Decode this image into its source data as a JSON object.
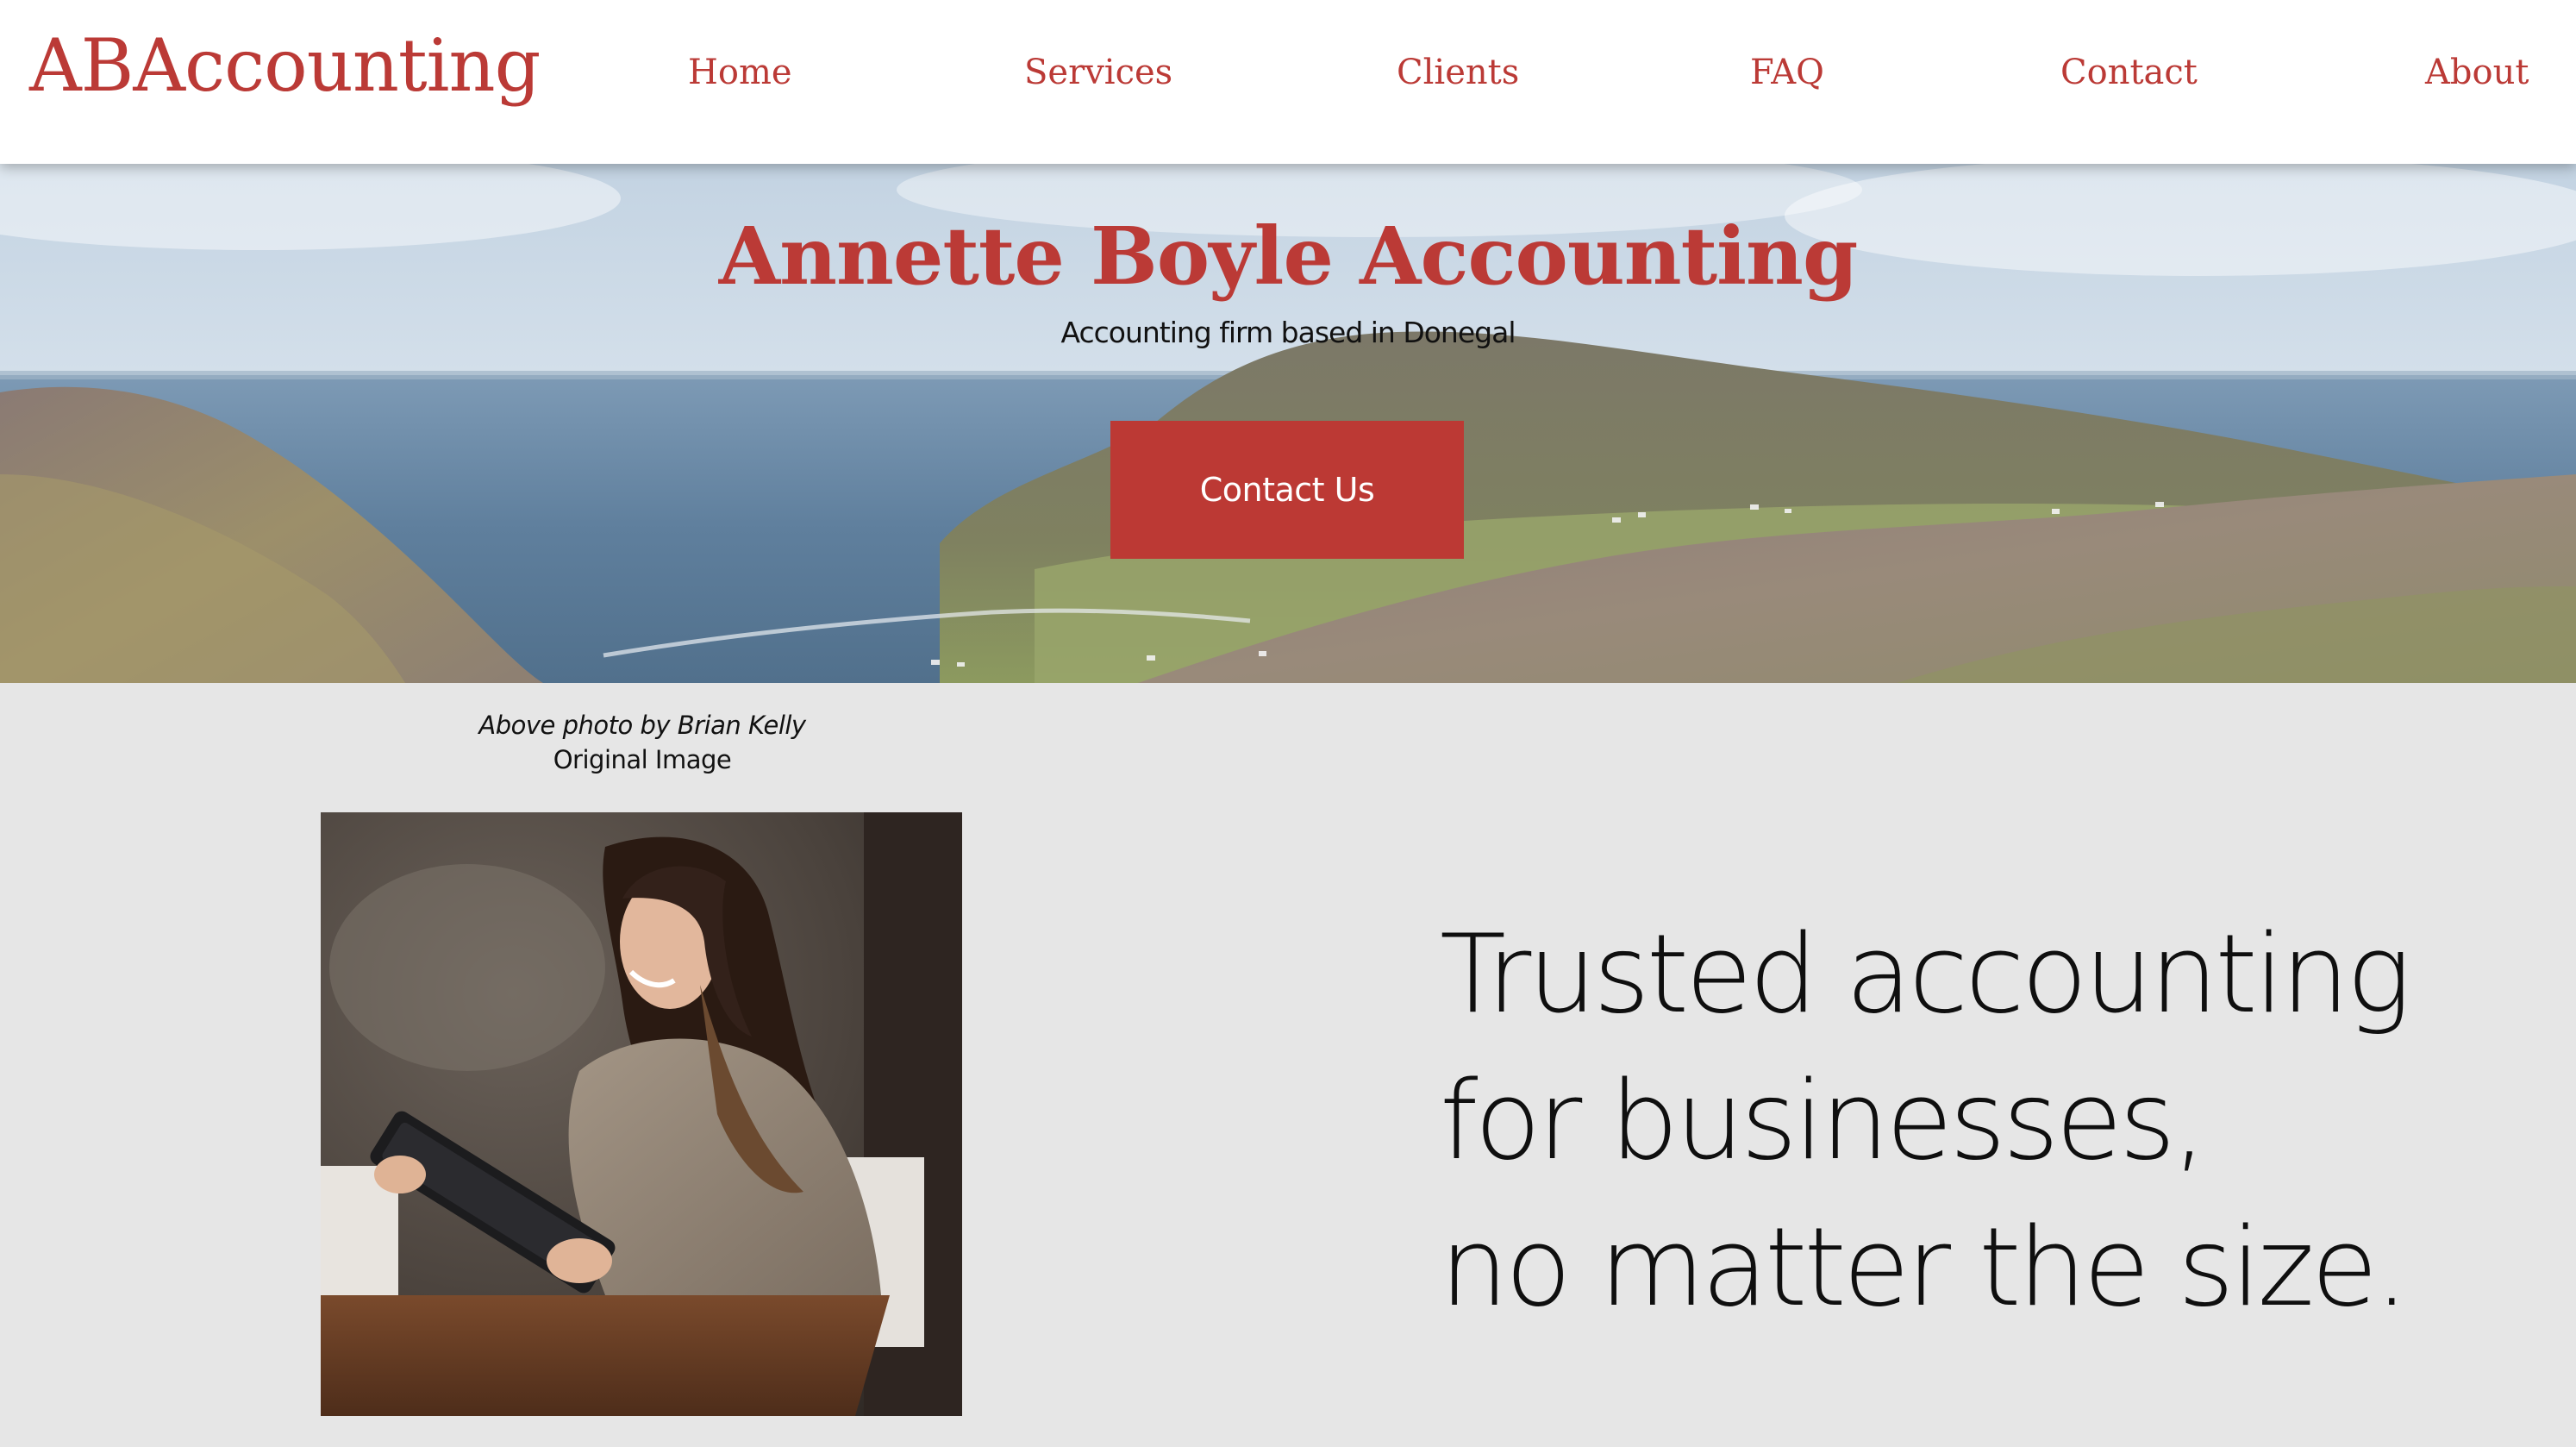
{
  "header": {
    "logo": "ABAccounting",
    "nav": [
      "Home",
      "Services",
      "Clients",
      "FAQ",
      "Contact",
      "About"
    ]
  },
  "hero": {
    "title": "Annette Boyle Accounting",
    "subtitle": "Accounting firm based in Donegal",
    "cta_label": "Contact Us"
  },
  "credit": {
    "line1": "Above photo by Brian Kelly",
    "line2": "Original Image"
  },
  "tagline": {
    "lines": [
      "Trusted accounting",
      "for businesses,",
      "no matter the size."
    ]
  },
  "colors": {
    "brand_red": "#bb3a36",
    "button_red": "#bc3934",
    "page_background": "#e6e6e6",
    "header_background": "#ffffff"
  }
}
